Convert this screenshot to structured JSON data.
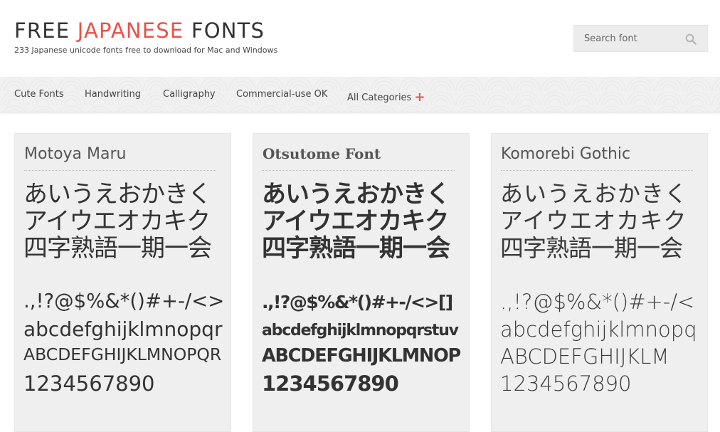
{
  "header": {
    "title_part1": "FREE ",
    "title_accent": "JAPANESE",
    "title_part2": " FONTS",
    "tagline": "233 Japanese unicode fonts free to download for Mac and Windows",
    "accent_color": "#e9524a"
  },
  "search": {
    "placeholder": "Search font",
    "icon": "search-icon"
  },
  "nav": {
    "items": [
      {
        "label": "Cute Fonts"
      },
      {
        "label": "Handwriting"
      },
      {
        "label": "Calligraphy"
      },
      {
        "label": "Commercial-use OK"
      },
      {
        "label": "All Categories"
      }
    ],
    "plus_symbol": "+"
  },
  "cards": [
    {
      "name": "Motoya Maru",
      "hiragana": "あいうえおかきく",
      "katakana": "アイウエオカキク",
      "kanji": "四字熟語一期一会",
      "symbols": ".,!?@$%&*()#+-/<>",
      "lowercase": "abcdefghijklmnopqr",
      "uppercase": "ABCDEFGHIJKLMNOPQR",
      "digits": "1234567890"
    },
    {
      "name": "Otsutome Font",
      "hiragana": "あいうえおかきく",
      "katakana": "アイウエオカキク",
      "kanji": "四字熟語一期一会",
      "symbols": ".,!?@$%&*()#+-/<>[]",
      "lowercase": "abcdefghijklmnopqrstuv",
      "uppercase": "ABCDEFGHIJKLMNOP",
      "digits": "1234567890"
    },
    {
      "name": "Komorebi Gothic",
      "hiragana": "あいうえおかきく",
      "katakana": "アイウエオカキク",
      "kanji": "四字熟語一期一会",
      "symbols": ".,!?@$%&*()#+-/<",
      "lowercase": "abcdefghijklmnopq",
      "uppercase": "ABCDEFGHIJKLM",
      "digits": "1234567890"
    }
  ]
}
